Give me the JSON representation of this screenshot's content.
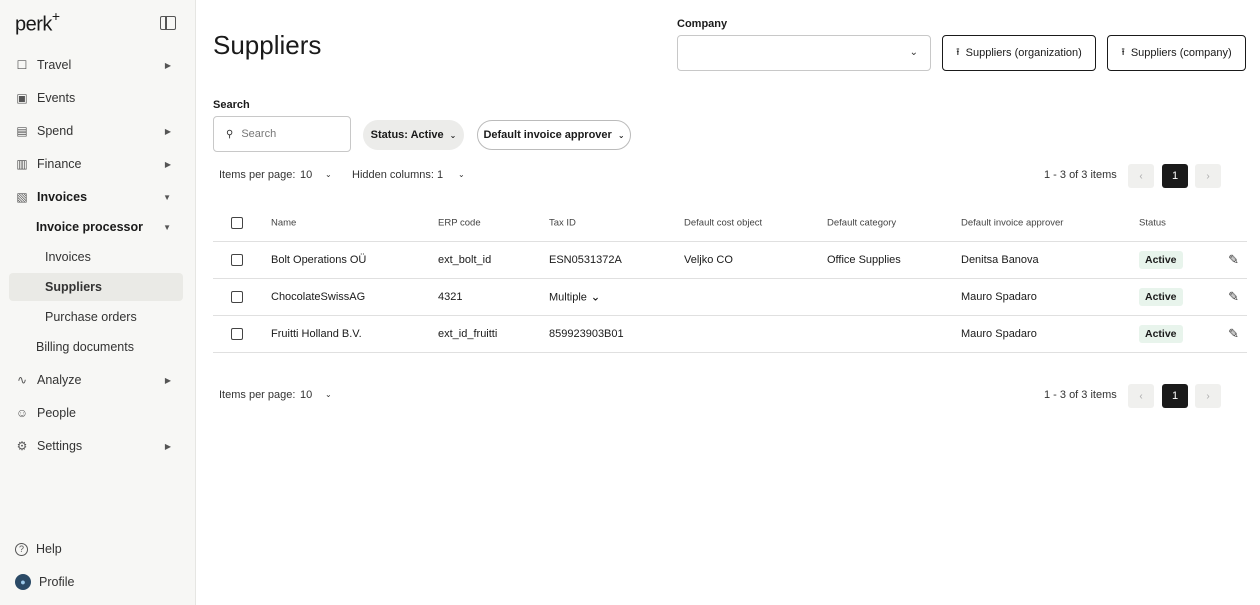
{
  "sidebar": {
    "logo": "perk",
    "logo_sup": "+",
    "items": [
      {
        "label": "Travel",
        "icon": "suitcase-icon",
        "glyph": "☐",
        "arrow": "▶"
      },
      {
        "label": "Events",
        "icon": "calendar-icon",
        "glyph": "▣"
      },
      {
        "label": "Spend",
        "icon": "money-icon",
        "glyph": "▤",
        "arrow": "▶"
      },
      {
        "label": "Finance",
        "icon": "ledger-icon",
        "glyph": "▥",
        "arrow": "▶"
      },
      {
        "label": "Invoices",
        "icon": "document-icon",
        "glyph": "▧",
        "arrow": "▼"
      },
      {
        "label": "Invoice processor",
        "arrow": "▼"
      },
      {
        "label": "Invoices"
      },
      {
        "label": "Suppliers"
      },
      {
        "label": "Purchase orders"
      },
      {
        "label": "Billing documents"
      },
      {
        "label": "Analyze",
        "icon": "trend-icon",
        "glyph": "∿",
        "arrow": "▶"
      },
      {
        "label": "People",
        "icon": "person-icon",
        "glyph": "☺"
      },
      {
        "label": "Settings",
        "icon": "gear-icon",
        "glyph": "⚙",
        "arrow": "▶"
      }
    ],
    "help": {
      "label": "Help",
      "glyph": "?"
    },
    "profile": {
      "label": "Profile",
      "glyph": "●"
    }
  },
  "header": {
    "title": "Suppliers",
    "company_label": "Company",
    "company_value": "",
    "chevron": "⌄",
    "export_org_label": "Suppliers (organization)",
    "export_company_label": "Suppliers (company)",
    "upload_glyph": "⭱"
  },
  "filters": {
    "search_label": "Search",
    "search_placeholder": "Search",
    "search_glyph": "⚲",
    "status_label": "Status: Active",
    "approver_label": "Default invoice approver",
    "chevron": "⌄"
  },
  "pager": {
    "items_per_page_label": "Items per page:",
    "items_per_page_value": "10",
    "hidden_columns_label": "Hidden columns:",
    "hidden_columns_value": "1",
    "range": "1 - 3 of 3 items",
    "current_page": "1",
    "prev": "‹",
    "next": "›",
    "chevron": "⌄"
  },
  "table": {
    "columns": [
      "Name",
      "ERP code",
      "Tax ID",
      "Default cost object",
      "Default category",
      "Default invoice approver",
      "Status"
    ],
    "rows": [
      {
        "name": "Bolt Operations OÜ",
        "erp": "ext_bolt_id",
        "tax": "ESN0531372A",
        "cost": "Veljko CO",
        "category": "Office Supplies",
        "approver": "Denitsa Banova",
        "status": "Active"
      },
      {
        "name": "ChocolateSwissAG",
        "erp": "4321",
        "tax": "Multiple",
        "cost": "",
        "category": "",
        "approver": "Mauro Spadaro",
        "status": "Active"
      },
      {
        "name": "Fruitti Holland B.V.",
        "erp": "ext_id_fruitti",
        "tax": "859923903B01",
        "cost": "",
        "category": "",
        "approver": "Mauro Spadaro",
        "status": "Active"
      }
    ],
    "edit_glyph": "✎",
    "multiple_chevron": "⌵"
  },
  "colors": {
    "accent": "#1a1a1a",
    "badge_bg": "#e8f4ec",
    "sidebar_bg": "#f7f7f5"
  }
}
